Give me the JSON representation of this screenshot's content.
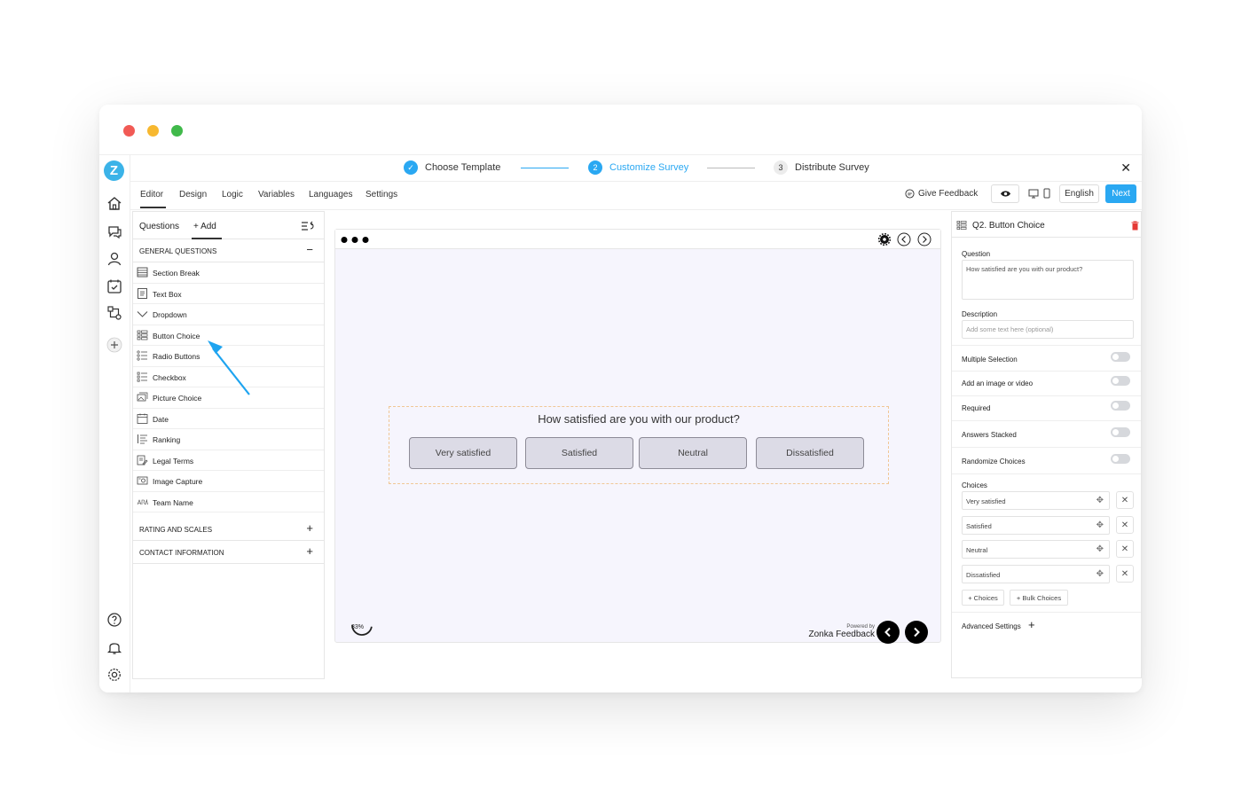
{
  "logo": {
    "letter": "Z"
  },
  "stepper": {
    "steps": [
      {
        "num": "✓",
        "label": "Choose Template",
        "state": "done"
      },
      {
        "num": "2",
        "label": "Customize Survey",
        "state": "active"
      },
      {
        "num": "3",
        "label": "Distribute Survey",
        "state": "pending"
      }
    ],
    "close": "✕"
  },
  "topnav": {
    "tabs": [
      "Editor",
      "Design",
      "Logic",
      "Variables",
      "Languages",
      "Settings"
    ],
    "active_tab": "Editor",
    "give_feedback": "Give Feedback",
    "language": "English",
    "next": "Next"
  },
  "questions_panel": {
    "title": "Questions",
    "add": "+ Add",
    "general": {
      "title": "GENERAL QUESTIONS",
      "toggle": "−",
      "items": [
        {
          "label": "Section Break",
          "icon": "section-break-icon"
        },
        {
          "label": "Text Box",
          "icon": "text-box-icon"
        },
        {
          "label": "Dropdown",
          "icon": "dropdown-icon"
        },
        {
          "label": "Button Choice",
          "icon": "button-choice-icon"
        },
        {
          "label": "Radio Buttons",
          "icon": "radio-buttons-icon"
        },
        {
          "label": "Checkbox",
          "icon": "checkbox-icon"
        },
        {
          "label": "Picture Choice",
          "icon": "picture-choice-icon"
        },
        {
          "label": "Date",
          "icon": "date-icon"
        },
        {
          "label": "Ranking",
          "icon": "ranking-icon"
        },
        {
          "label": "Legal Terms",
          "icon": "legal-terms-icon"
        },
        {
          "label": "Image Capture",
          "icon": "image-capture-icon"
        },
        {
          "label": "Team Name",
          "icon": "team-name-icon"
        }
      ]
    },
    "rating": {
      "title": "RATING AND SCALES",
      "toggle": "+"
    },
    "contact": {
      "title": "CONTACT INFORMATION",
      "toggle": "+"
    }
  },
  "canvas": {
    "question": "How satisfied are you with our product?",
    "choices": [
      "Very satisfied",
      "Satisfied",
      "Neutral",
      "Dissatisfied"
    ],
    "progress": "33%",
    "progress_fraction": 0.33,
    "powered_by": "Powered by",
    "brand": "Zonka Feedback"
  },
  "right_panel": {
    "title": "Q2. Button Choice",
    "question_label": "Question",
    "question_value": "How satisfied are you with our product?",
    "description_label": "Description",
    "description_placeholder": "Add some text here (optional)",
    "toggles": [
      {
        "label": "Multiple Selection",
        "on": false
      },
      {
        "label": "Add an image or video",
        "on": false
      },
      {
        "label": "Required",
        "on": false
      },
      {
        "label": "Answers Stacked",
        "on": false
      },
      {
        "label": "Randomize Choices",
        "on": false
      }
    ],
    "choices_label": "Choices",
    "choices": [
      "Very satisfied",
      "Satisfied",
      "Neutral",
      "Dissatisfied"
    ],
    "add_choices": "+ Choices",
    "bulk_choices": "+ Bulk Choices",
    "advanced": "Advanced Settings",
    "advanced_toggle": "+"
  },
  "colors": {
    "accent": "#2aa8f2",
    "close_red": "#ff5f57",
    "minimize_yellow": "#febc2e",
    "maximize_green": "#28c840",
    "delete_red": "#e53935",
    "arrow_blue": "#1ea4f0"
  }
}
